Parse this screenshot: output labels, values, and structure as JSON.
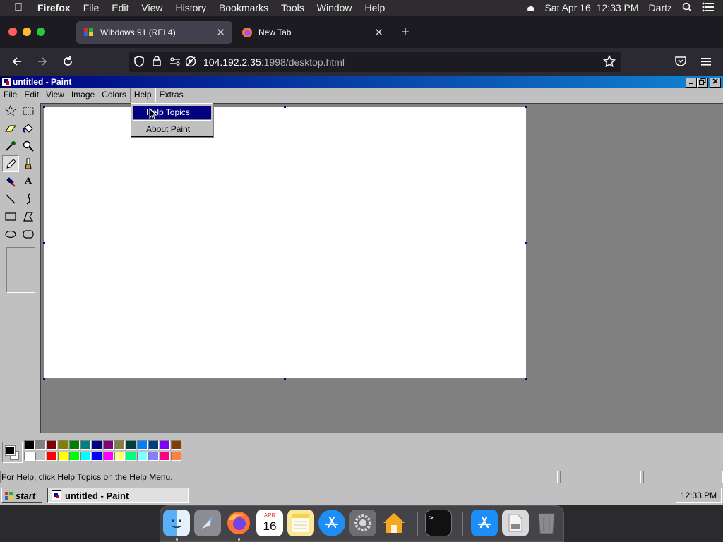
{
  "mac_menubar": {
    "apple": "",
    "app_name": "Firefox",
    "menus": [
      "File",
      "Edit",
      "View",
      "History",
      "Bookmarks",
      "Tools",
      "Window",
      "Help"
    ],
    "datetime": "Sat Apr 16  12:33 PM",
    "user": "Dartz"
  },
  "browser": {
    "tabs": [
      {
        "label": "Wibdows 91 (REL4)",
        "active": true
      },
      {
        "label": "New Tab",
        "active": false
      }
    ],
    "url_host": "104.192.2.35",
    "url_path": ":1998/desktop.html"
  },
  "paint": {
    "title": "untitled - Paint",
    "menus": [
      "File",
      "Edit",
      "View",
      "Image",
      "Colors",
      "Help",
      "Extras"
    ],
    "open_menu": "Help",
    "help_menu": [
      "Help Topics",
      "About Paint"
    ],
    "highlighted_item": "Help Topics",
    "tools": [
      "free-select",
      "rect-select",
      "eraser",
      "fill",
      "color-picker",
      "magnifier",
      "pencil",
      "brush",
      "airbrush",
      "text",
      "line",
      "curve",
      "rectangle",
      "polygon",
      "ellipse",
      "rounded-rectangle"
    ],
    "selected_tool": "pencil",
    "foreground_color": "#000000",
    "background_color": "#ffffff",
    "palette_top": [
      "#000000",
      "#808080",
      "#800000",
      "#808000",
      "#008000",
      "#008080",
      "#000080",
      "#800080",
      "#808040",
      "#004040",
      "#0080ff",
      "#004080",
      "#8000ff",
      "#804000"
    ],
    "palette_bottom": [
      "#ffffff",
      "#c0c0c0",
      "#ff0000",
      "#ffff00",
      "#00ff00",
      "#00ffff",
      "#0000ff",
      "#ff00ff",
      "#ffff80",
      "#00ff80",
      "#80ffff",
      "#8080ff",
      "#ff0080",
      "#ff8040"
    ],
    "status_text": "For Help, click Help Topics on the Help Menu."
  },
  "taskbar": {
    "start_label": "start",
    "task_label": "untitled - Paint",
    "clock": "12:33 PM"
  },
  "dock": {
    "apps": [
      "Finder",
      "Launchpad",
      "Firefox",
      "Calendar",
      "Notes",
      "App Store",
      "System Preferences",
      "Home",
      "Terminal",
      "Applications",
      "Files",
      "Trash"
    ],
    "calendar_month": "APR",
    "calendar_day": "16"
  }
}
